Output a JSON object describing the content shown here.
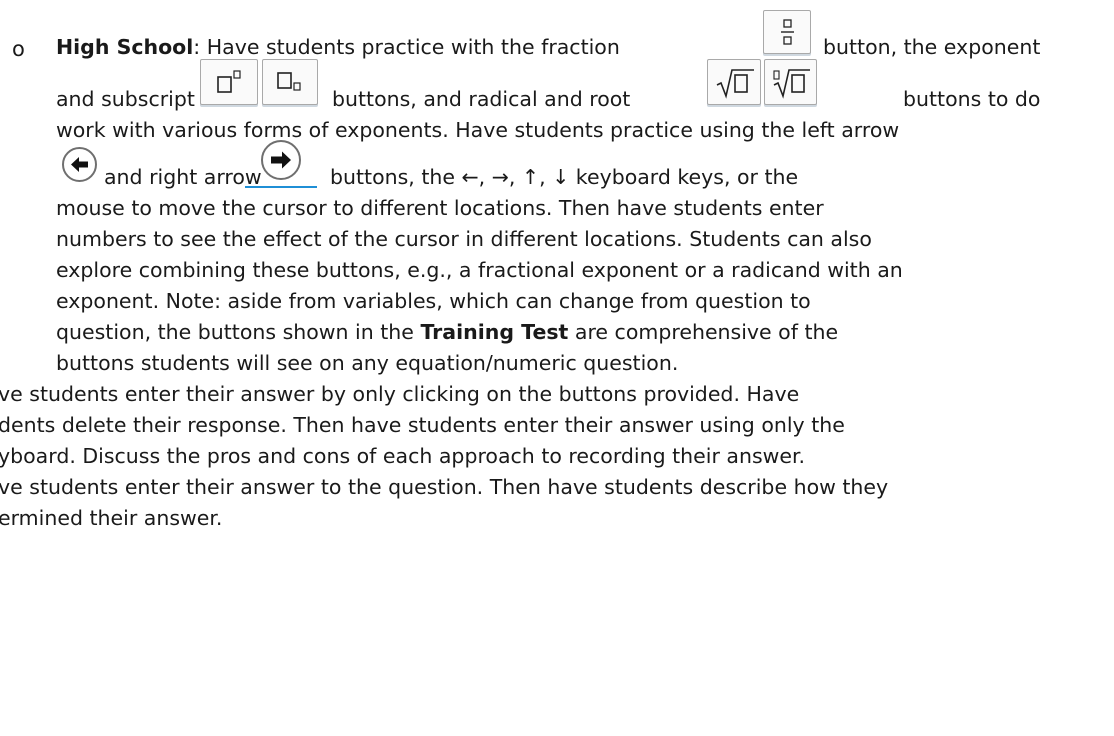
{
  "bullet_symbol": "o",
  "paragraph": {
    "heading": "High School",
    "l1_a": ": Have students practice with the fraction",
    "l1_b": "button, the exponent",
    "l2_a": "and subscript",
    "l2_b": "buttons, and radical and root",
    "l2_c": "buttons to do",
    "l3": "work with various forms of exponents. Have students practice using the left arrow",
    "l4_a": "and right arrow",
    "l4_b": "buttons, the ←, →, ↑, ↓ keyboard keys, or the",
    "l5": "mouse to move the cursor to different locations. Then have students enter",
    "l6": "numbers to see the effect of the cursor in different locations. Students can also",
    "l7": "explore combining these buttons, e.g., a fractional exponent or a radicand with an",
    "l8": "exponent. Note: aside from variables, which can change from question to",
    "l9_a": "question, the buttons shown in the",
    "l9_bold": "Training Test",
    "l9_b": "are comprehensive of the",
    "l10": "buttons students will see on any equation/numeric question."
  },
  "lines_below": [
    "ve students enter their answer by only clicking on the buttons provided. Have",
    "dents delete their response. Then have students enter their answer using only the",
    "yboard. Discuss the pros and cons of each approach to recording their answer.",
    "ve students enter their answer to the question. Then have students describe how they",
    "ermined their answer."
  ],
  "buttons": {
    "fraction": "fraction-button",
    "exponent": "exponent-button",
    "subscript": "subscript-button",
    "radical": "radical-button",
    "root": "root-button",
    "left_arrow": "left-arrow-button",
    "right_arrow": "right-arrow-button"
  }
}
